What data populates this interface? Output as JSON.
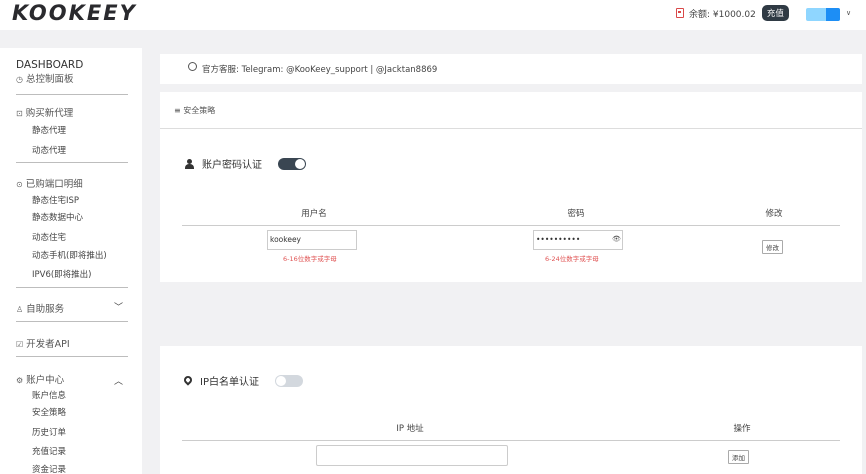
{
  "header": {
    "logo": "KOOKEEY",
    "balance_label": "余额: ¥1000.02",
    "recharge_label": "充值",
    "user_caret": "∨"
  },
  "sidebar": {
    "dashboard_title": "DASHBOARD",
    "dashboard_sub": "总控制面板",
    "buy_proxy": "购买新代理",
    "buy_items": [
      "静态代理",
      "动态代理"
    ],
    "purchased": "已购端口明细",
    "purchased_items": [
      "静态住宅ISP",
      "静态数据中心",
      "动态住宅",
      "动态手机(即将推出)",
      "IPV6(即将推出)"
    ],
    "self_service": "自助服务",
    "developer_api": "开发者API",
    "account_center": "账户中心",
    "account_items": [
      "账户信息",
      "安全策略",
      "历史订单",
      "充值记录",
      "资金记录"
    ]
  },
  "announcement": {
    "text": "官方客服:   Telegram: @KooKeey_support  |  @Jacktan8869"
  },
  "security": {
    "heading": "≡ 安全策略",
    "auth_title": "账户密码认证",
    "auth_enabled": true,
    "columns": [
      "用户名",
      "密码",
      "修改"
    ],
    "username_value": "kookeey",
    "username_hint": "6-16位数字或字母",
    "password_value": "••••••••••",
    "password_hint": "6-24位数字或字母",
    "modify_label": "修改"
  },
  "ip_whitelist": {
    "title": "IP白名单认证",
    "enabled": false,
    "columns": [
      "IP 地址",
      "操作"
    ],
    "add_label": "添加",
    "ip_value": ""
  },
  "colors": {
    "toggle_on": "#3a4652",
    "toggle_off": "#d3d8de",
    "hint_red": "#e05555",
    "recharge_bg": "#2f3a44",
    "user_badge": "#1d8ef5"
  }
}
